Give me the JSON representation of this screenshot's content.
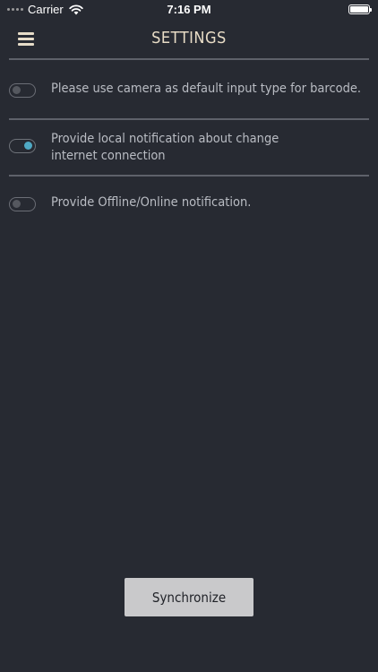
{
  "status_bar": {
    "carrier": "Carrier",
    "time": "7:16 PM",
    "icons": [
      "signal-dots-icon",
      "wifi-icon",
      "battery-icon"
    ]
  },
  "header": {
    "title": "SETTINGS",
    "menu_icon": "hamburger-menu-icon"
  },
  "settings": [
    {
      "label_lines": [
        "Please use camera as default input type for barcode."
      ],
      "enabled": false
    },
    {
      "label_lines": [
        "Provide local notification about change",
        "internet connection"
      ],
      "enabled": true
    },
    {
      "label_lines": [
        "Provide Offline/Online notification."
      ],
      "enabled": false
    }
  ],
  "sync_button": {
    "label": "Synchronize"
  },
  "colors": {
    "background": "#272a32",
    "title": "#e8dcc6",
    "label": "#b9bcc3",
    "toggle_on_knob": "#4fa9c4",
    "divider": "#5e616a",
    "button_bg": "#c9c9cb"
  }
}
